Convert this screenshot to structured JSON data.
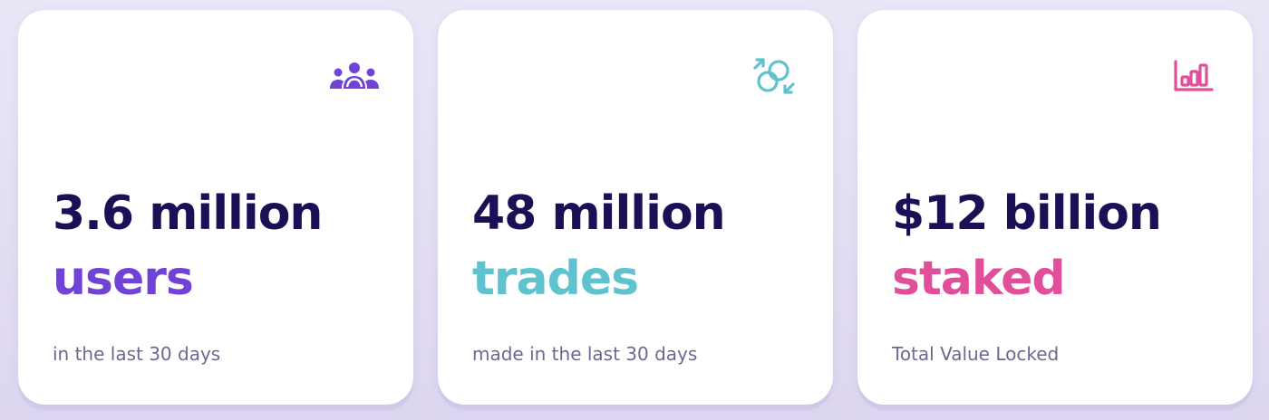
{
  "stats": [
    {
      "icon": "users-icon",
      "headline": "3.6 million",
      "accent": "users",
      "caption": "in the last 30 days",
      "accent_color": "#7043d6"
    },
    {
      "icon": "trades-icon",
      "headline": "48 million",
      "accent": "trades",
      "caption": "made in the last 30 days",
      "accent_color": "#5fc2cf"
    },
    {
      "icon": "bar-chart-icon",
      "headline": "$12 billion",
      "accent": "staked",
      "caption": "Total Value Locked",
      "accent_color": "#e14f9b"
    }
  ],
  "colors": {
    "headline": "#1d0f56",
    "caption": "#6e6891",
    "card": "#ffffff"
  }
}
